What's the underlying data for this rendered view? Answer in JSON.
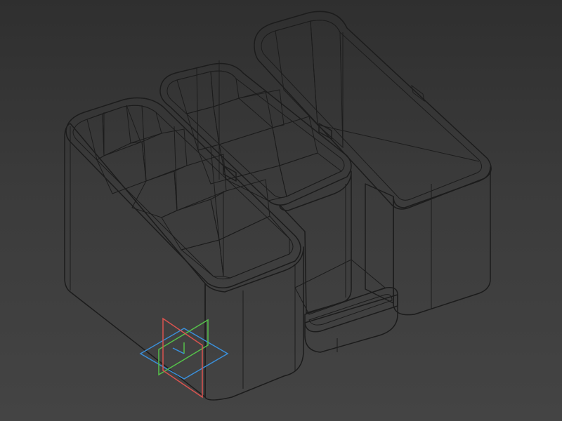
{
  "viewport": {
    "background_top": "#2f2f2f",
    "background_bottom": "#444444"
  },
  "model": {
    "name": "desk organizer",
    "face_colors": {
      "left": "#a8a8a8",
      "right": "#c2c2c2",
      "top": "#d2d2d2",
      "inner_dark": "#8e8e8e",
      "inner_light": "#b5b5b5",
      "edge": "#1c1c1c"
    }
  },
  "axis_gizmo": {
    "planes": [
      "xy-plane",
      "xz-plane",
      "yz-plane"
    ],
    "colors": {
      "red": "#d9534f",
      "green": "#55c04a",
      "blue": "#3b8fd9"
    }
  }
}
